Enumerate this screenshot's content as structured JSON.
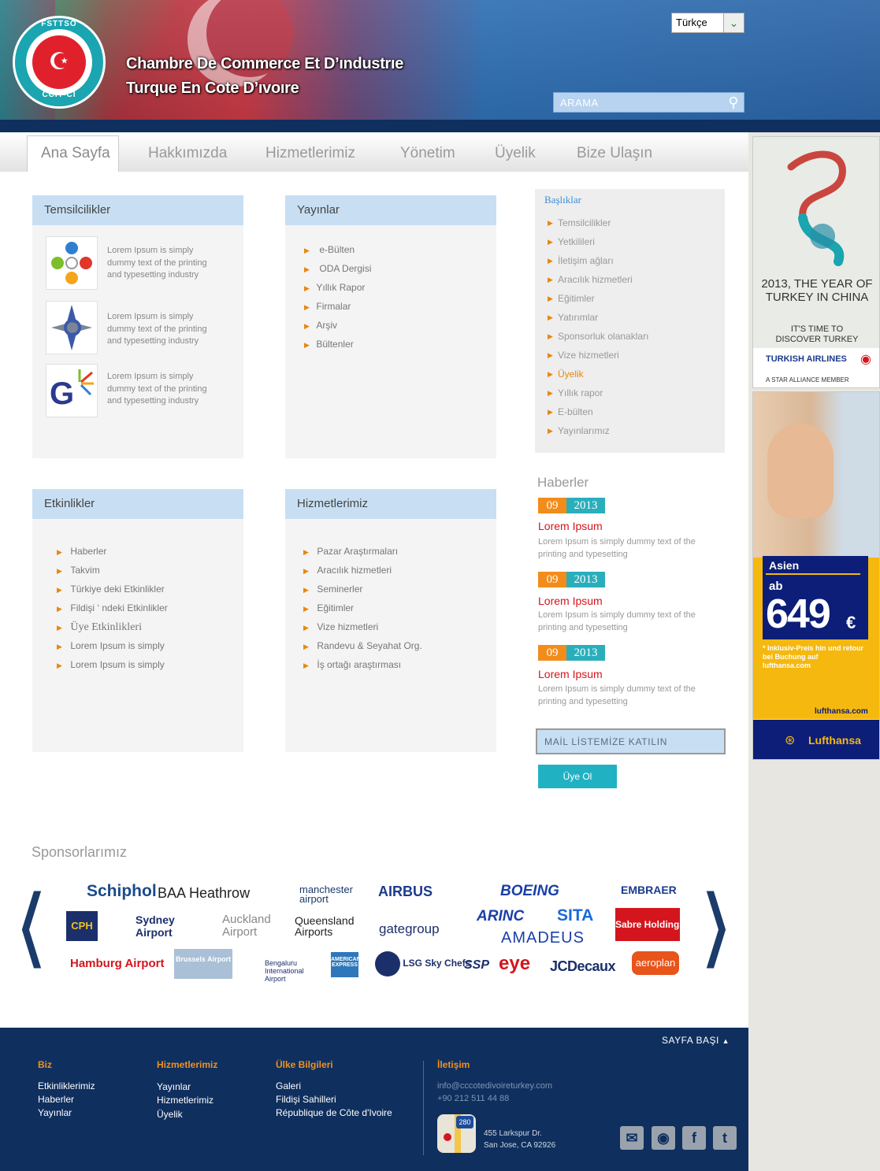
{
  "header": {
    "title_line1": "Chambre De Commerce  Et D’ındustrıe",
    "title_line2": "Turque En Cote D’ıvoıre",
    "logo_top": "FSTTSO",
    "logo_bottom": "CCIT-CI",
    "language": "Türkçe",
    "search_placeholder": "ARAMA"
  },
  "nav": [
    "Ana Sayfa",
    "Hakkımızda",
    "Hizmetlerimiz",
    "Yönetim",
    "Üyelik",
    "Bize Ulaşın"
  ],
  "temsilcilikler": {
    "title": "Temsilcilikler",
    "items": [
      "Lorem Ipsum is simply dummy text of the printing and typesetting industry",
      "Lorem Ipsum is simply dummy text of the printing and typesetting industry",
      "Lorem Ipsum is simply dummy text of the printing and typesetting industry"
    ]
  },
  "yayinlar": {
    "title": "Yayınlar",
    "items": [
      "e-Bülten",
      "ODA Dergisi",
      "Yıllık Rapor",
      "Firmalar",
      "Arşiv",
      "Bültenler"
    ]
  },
  "etkinlikler": {
    "title": "Etkinlikler",
    "items": [
      "Haberler",
      "Takvim",
      "Türkiye deki Etkinlikler",
      "Fildişi ‘ ndeki Etkinlikler",
      "Üye Etkinlikleri",
      "Lorem Ipsum is simply",
      "Lorem Ipsum is simply"
    ]
  },
  "hizmetlerimiz": {
    "title": "Hizmetlerimiz",
    "items": [
      "Pazar Araştırmaları",
      "Aracılık hizmetleri",
      "Seminerler",
      "Eğitimler",
      "Vize hizmetleri",
      "Randevu & Seyahat Org.",
      "İş ortağı araştırması"
    ]
  },
  "basliklar": {
    "title": "Başlıklar",
    "items": [
      "Temsilcilikler",
      "Yetkilileri",
      "İletişim ağları",
      "Aracılık hizmetleri",
      "Eğitimler",
      "Yatırımlar",
      "Sponsorluk olanakları",
      "Vize hizmetleri",
      "Üyelik",
      "Yıllık rapor",
      "E-bülten",
      "Yayınlarımız"
    ],
    "highlight_index": 8
  },
  "haberler": {
    "title": "Haberler",
    "items": [
      {
        "month": "09",
        "year": "2013",
        "title": "Lorem Ipsum",
        "desc": "Lorem Ipsum is simply dummy text of the printing and typesetting"
      },
      {
        "month": "09",
        "year": "2013",
        "title": "Lorem Ipsum",
        "desc": "Lorem Ipsum is simply dummy text of the printing and typesetting"
      },
      {
        "month": "09",
        "year": "2013",
        "title": "Lorem Ipsum",
        "desc": "Lorem Ipsum is simply dummy text of the printing and typesetting"
      }
    ]
  },
  "newsletter": {
    "title": "MAİL LİSTEMİZE KATILIN",
    "button": "Üye Ol"
  },
  "sponsors": {
    "title": "Sponsorlarımız",
    "logos": [
      "Schiphol",
      "BAA Heathrow",
      "manchester airport",
      "AIRBUS",
      "BOEING",
      "EMBRAER",
      "CPH",
      "Sydney Airport",
      "Auckland Airport",
      "Queensland Airports",
      "gategroup",
      "ARINC",
      "SITA",
      "Sabre Holdings",
      "AMADEUS",
      "Hamburg Airport",
      "Brussels Airport",
      "Bengaluru International Airport",
      "AMERICAN EXPRESS",
      "LSG Sky Chefs",
      "SSP",
      "eye",
      "JCDecaux",
      "aeroplan"
    ]
  },
  "ads": {
    "turkish": {
      "headline": "2013, THE YEAR OF TURKEY IN CHINA",
      "sub": "IT'S TIME TO DISCOVER TURKEY",
      "brand": "TURKISH AIRLINES",
      "alliance": "A STAR ALLIANCE MEMBER"
    },
    "lufthansa": {
      "region": "Asien",
      "ab": "ab",
      "price": "649",
      "currency": "€",
      "note": "* Inklusiv-Preis hin und retour bei Buchung auf lufthansa.com",
      "site": "lufthansa.com",
      "brand": "Lufthansa"
    }
  },
  "footer": {
    "back_to_top": "SAYFA BAŞI",
    "col1": {
      "title": "Biz",
      "links": [
        "Etkinliklerimiz",
        "Haberler",
        "Yayınlar"
      ]
    },
    "col2": {
      "title": "Hizmetlerimiz",
      "links": [
        "Yayınlar",
        "Hizmetlerimiz",
        "Üyelik"
      ]
    },
    "col3": {
      "title": "Ülke Bilgileri",
      "links": [
        "Galeri",
        "Fildişi Sahilleri",
        "République de Côte d'Ivoire"
      ]
    },
    "contact": {
      "title": "İletişim",
      "email": "info@cccotedivoireturkey.com",
      "phone": "+90 212 511 44 88",
      "address1": "455 Larkspur Dr.",
      "address2": "San Jose, CA 92926",
      "map_badge": "280"
    }
  },
  "colors": {
    "accent_orange": "#f28c1b",
    "accent_teal": "#2aaebc",
    "header_blue": "#2c65a8",
    "footer_navy": "#0f2f5e",
    "news_red": "#d5151d"
  }
}
